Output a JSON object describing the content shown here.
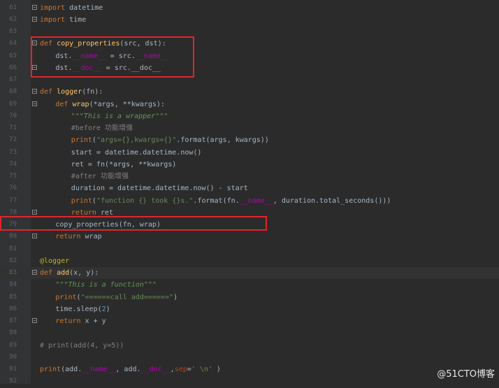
{
  "editor": {
    "lines": [
      {
        "n": "61",
        "fold": true,
        "indent": 0,
        "tokens": [
          [
            "kw",
            "import"
          ],
          [
            "p",
            " datetime"
          ]
        ]
      },
      {
        "n": "62",
        "fold": true,
        "indent": 0,
        "tokens": [
          [
            "kw",
            "import"
          ],
          [
            "p",
            " time"
          ]
        ]
      },
      {
        "n": "63",
        "fold": false,
        "indent": 0,
        "tokens": []
      },
      {
        "n": "64",
        "fold": true,
        "indent": 0,
        "tokens": [
          [
            "kw",
            "def "
          ],
          [
            "fn",
            "copy_properties"
          ],
          [
            "p",
            "(src, dst):"
          ]
        ]
      },
      {
        "n": "65",
        "fold": false,
        "indent": 2,
        "tokens": [
          [
            "p",
            "dst."
          ],
          [
            "dunder",
            "__name__"
          ],
          [
            "p",
            " = src."
          ],
          [
            "dunder",
            "__name__"
          ]
        ]
      },
      {
        "n": "66",
        "fold": true,
        "indent": 2,
        "tokens": [
          [
            "p",
            "dst."
          ],
          [
            "dunder",
            "__doc__"
          ],
          [
            "p",
            " = src.__doc__"
          ]
        ]
      },
      {
        "n": "67",
        "fold": false,
        "indent": 0,
        "tokens": []
      },
      {
        "n": "68",
        "fold": true,
        "indent": 0,
        "tokens": [
          [
            "kw",
            "def "
          ],
          [
            "fn",
            "logger"
          ],
          [
            "p",
            "(fn):"
          ]
        ]
      },
      {
        "n": "69",
        "fold": true,
        "indent": 2,
        "tokens": [
          [
            "kw",
            "def "
          ],
          [
            "fn",
            "wrap"
          ],
          [
            "p",
            "(*args, **kwargs):"
          ]
        ]
      },
      {
        "n": "70",
        "fold": false,
        "indent": 4,
        "tokens": [
          [
            "doc",
            "\"\"\"This is a wrapper\"\"\""
          ]
        ]
      },
      {
        "n": "71",
        "fold": false,
        "indent": 4,
        "tokens": [
          [
            "cmt",
            "#before 功能增强"
          ]
        ]
      },
      {
        "n": "72",
        "fold": false,
        "indent": 4,
        "tokens": [
          [
            "kw",
            "print"
          ],
          [
            "p",
            "("
          ],
          [
            "str",
            "\"args={},kwargs={}\""
          ],
          [
            "p",
            ".format(args, kwargs))"
          ]
        ]
      },
      {
        "n": "73",
        "fold": false,
        "indent": 4,
        "tokens": [
          [
            "p",
            "start = datetime.datetime.now()"
          ]
        ]
      },
      {
        "n": "74",
        "fold": false,
        "indent": 4,
        "tokens": [
          [
            "p",
            "ret = fn(*args, **kwargs)"
          ]
        ]
      },
      {
        "n": "75",
        "fold": false,
        "indent": 4,
        "tokens": [
          [
            "cmt",
            "#after 功能增强"
          ]
        ]
      },
      {
        "n": "76",
        "fold": false,
        "indent": 4,
        "tokens": [
          [
            "p",
            "duration = datetime.datetime.now() - start"
          ]
        ]
      },
      {
        "n": "77",
        "fold": false,
        "indent": 4,
        "tokens": [
          [
            "kw",
            "print"
          ],
          [
            "p",
            "("
          ],
          [
            "str",
            "\"function {} took {}s.\""
          ],
          [
            "p",
            ".format(fn."
          ],
          [
            "dunder",
            "__name__"
          ],
          [
            "p",
            ", duration.total_seconds()))"
          ]
        ]
      },
      {
        "n": "78",
        "fold": true,
        "indent": 4,
        "tokens": [
          [
            "kw",
            "return"
          ],
          [
            "p",
            " ret"
          ]
        ]
      },
      {
        "n": "79",
        "fold": false,
        "indent": 2,
        "tokens": [
          [
            "p",
            "copy_properties(fn, wrap)"
          ]
        ]
      },
      {
        "n": "80",
        "fold": true,
        "indent": 2,
        "tokens": [
          [
            "kw",
            "return"
          ],
          [
            "p",
            " wrap"
          ]
        ]
      },
      {
        "n": "81",
        "fold": false,
        "indent": 0,
        "tokens": []
      },
      {
        "n": "82",
        "fold": false,
        "indent": 0,
        "tokens": [
          [
            "deco",
            "@logger"
          ]
        ]
      },
      {
        "n": "83",
        "fold": true,
        "indent": 0,
        "current": true,
        "tokens": [
          [
            "kw",
            "def "
          ],
          [
            "fn",
            "add"
          ],
          [
            "p",
            "(x, y):"
          ]
        ]
      },
      {
        "n": "84",
        "fold": false,
        "indent": 2,
        "tokens": [
          [
            "doc",
            "\"\"\"This is a function\"\"\""
          ]
        ]
      },
      {
        "n": "85",
        "fold": false,
        "indent": 2,
        "tokens": [
          [
            "kw",
            "print"
          ],
          [
            "p",
            "("
          ],
          [
            "str",
            "\"======call add======\""
          ],
          [
            "p",
            ")"
          ]
        ]
      },
      {
        "n": "86",
        "fold": false,
        "indent": 2,
        "tokens": [
          [
            "p",
            "time.sleep("
          ],
          [
            "num",
            "2"
          ],
          [
            "p",
            ")"
          ]
        ]
      },
      {
        "n": "87",
        "fold": true,
        "indent": 2,
        "tokens": [
          [
            "kw",
            "return"
          ],
          [
            "p",
            " x + y"
          ]
        ]
      },
      {
        "n": "88",
        "fold": false,
        "indent": 0,
        "tokens": []
      },
      {
        "n": "89",
        "fold": false,
        "indent": 0,
        "tokens": [
          [
            "cmt",
            "# print(add(4, y=5))"
          ]
        ]
      },
      {
        "n": "90",
        "fold": false,
        "indent": 0,
        "tokens": []
      },
      {
        "n": "91",
        "fold": false,
        "indent": 0,
        "tokens": [
          [
            "kw",
            "print"
          ],
          [
            "p",
            "(add."
          ],
          [
            "dunder",
            "__name__"
          ],
          [
            "p",
            ", add."
          ],
          [
            "dunder",
            "__doc__"
          ],
          [
            "p",
            ","
          ],
          [
            "kwarg",
            "sep"
          ],
          [
            "p",
            "="
          ],
          [
            "str",
            "' \\n'"
          ],
          [
            "p",
            " )"
          ]
        ]
      },
      {
        "n": "92",
        "fold": false,
        "indent": 0,
        "tokens": []
      }
    ]
  },
  "watermark": "@51CTO博客",
  "colors": {
    "highlight_box": "#e0252e",
    "background": "#2b2b2b"
  }
}
